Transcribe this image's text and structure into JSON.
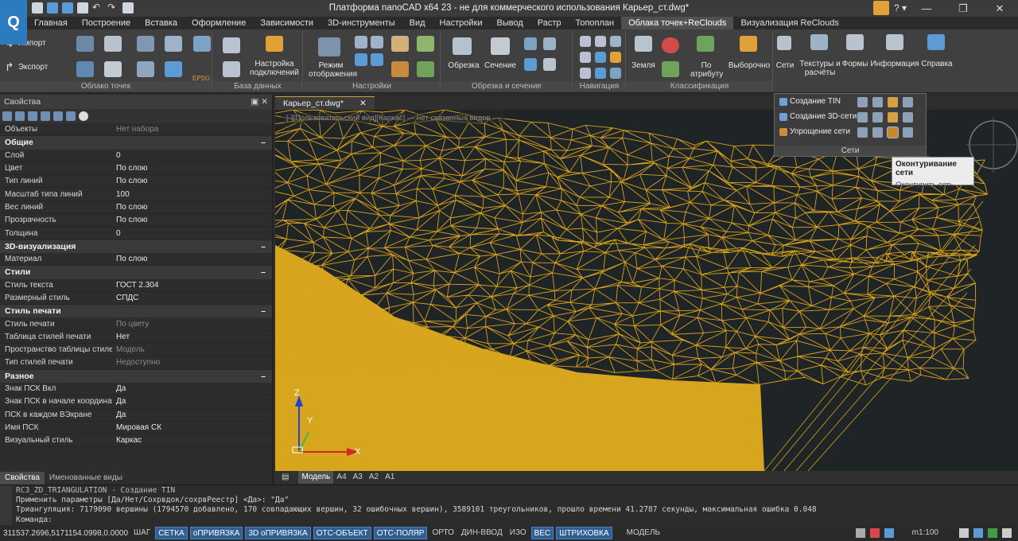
{
  "window": {
    "title": "Платформа nanoCAD x64 23 - не для коммерческого использования Карьер_ст.dwg*"
  },
  "app": {
    "logo_letter": "Q"
  },
  "ribbon_tabs": [
    "Главная",
    "Построение",
    "Вставка",
    "Оформление",
    "Зависимости",
    "3D-инструменты",
    "Вид",
    "Настройки",
    "Вывод",
    "Растр",
    "Топоплан",
    "Облака точек+ReClouds",
    "Визуализация ReClouds"
  ],
  "active_tab": "Облака точек+ReClouds",
  "ribbon": {
    "import_label": "Импорт",
    "export_label": "Экспорт",
    "epsg_label": "EPSG",
    "group_cloud": "Облако точек",
    "connections_label": "Настройка подключений",
    "group_db": "База данных",
    "display_mode_label": "Режим отображения",
    "group_settings": "Настройки",
    "cut_label": "Обрезка",
    "section_label": "Сечение",
    "group_cut": "Обрезка и сечение",
    "group_nav": "Навигация",
    "ground_label": "Земля",
    "by_attr_label": "По атрибуту",
    "selective_label": "Выборочно",
    "group_classif": "Классификация",
    "meshes_label": "Сети",
    "textures_label": "Текстуры и расчёты",
    "forms_label": "Формы",
    "info_label": "Информация",
    "help_label": "Справка"
  },
  "properties": {
    "header": "Свойства",
    "objects_key": "Объекты",
    "objects_val": "Нет набора",
    "sections": [
      {
        "title": "Общие",
        "rows": [
          {
            "k": "Слой",
            "v": "0"
          },
          {
            "k": "Цвет",
            "v": "По слою"
          },
          {
            "k": "Тип линий",
            "v": "По слою"
          },
          {
            "k": "Масштаб типа линий",
            "v": "100"
          },
          {
            "k": "Вес линий",
            "v": "По слою"
          },
          {
            "k": "Прозрачность",
            "v": "По слою"
          },
          {
            "k": "Толщина",
            "v": "0"
          }
        ]
      },
      {
        "title": "3D-визуализация",
        "rows": [
          {
            "k": "Материал",
            "v": "По слою"
          }
        ]
      },
      {
        "title": "Стили",
        "rows": [
          {
            "k": "Стиль текста",
            "v": "ГОСТ 2.304"
          },
          {
            "k": "Размерный стиль",
            "v": "СПДС"
          }
        ]
      },
      {
        "title": "Стиль печати",
        "rows": [
          {
            "k": "Стиль печати",
            "v": "По цвету"
          },
          {
            "k": "Таблица стилей печати",
            "v": "Нет"
          },
          {
            "k": "Пространство таблицы стилей п...",
            "v": "Модель"
          },
          {
            "k": "Тип стилей печати",
            "v": "Недоступно"
          }
        ]
      },
      {
        "title": "Разное",
        "rows": [
          {
            "k": "Знак ПСК Вкл",
            "v": "Да"
          },
          {
            "k": "Знак ПСК в начале координат",
            "v": "Да"
          },
          {
            "k": "ПСК в каждом ВЭкране",
            "v": "Да"
          },
          {
            "k": "Имя ПСК",
            "v": "Мировая СК"
          },
          {
            "k": "Визуальный стиль",
            "v": "Каркас"
          }
        ]
      }
    ],
    "bottom_tabs": [
      "Свойства",
      "Именованные виды"
    ]
  },
  "document": {
    "tab_label": "Карьер_ст.dwg*",
    "viewport_header": "[-][Пользовательский вид][Каркас] — нет связанных видов —"
  },
  "axes": {
    "z": "Z",
    "y": "Y",
    "x": "X"
  },
  "layout_tabs": [
    "Модель",
    "A4",
    "A3",
    "A2",
    "A1"
  ],
  "mesh_popup": {
    "items": [
      "Создание TIN",
      "Создание 3D-сети",
      "Упрощение сети"
    ],
    "footer": "Сети"
  },
  "tooltip": {
    "title": "Оконтуривание сети",
    "desc": "Оконтурить сеть"
  },
  "command_line": {
    "lines": [
      "RC3_ZD_TRIANGULATION - Создание TIN",
      "Применить параметры [Да/Нет/Сохрвдок/сохрвРеестр] <Да>: \"Да\"",
      "Триангуляция: 7179090 вершины (1794570 добавлено, 170 совпадающих вершин, 32 ошибочных вершин), 3589101 треугольников, прошло времени 41.2787 секунды, максимальная ошибка 0.048",
      "Команда:"
    ]
  },
  "status": {
    "coords": "311537.2696,5171154.0998,0.0000",
    "toggles": [
      {
        "label": "ШАГ",
        "on": false
      },
      {
        "label": "СЕТКА",
        "on": true
      },
      {
        "label": "оПРИВЯЗКА",
        "on": true
      },
      {
        "label": "3D оПРИВЯЗКА",
        "on": true
      },
      {
        "label": "ОТС-ОБЪЕКТ",
        "on": true
      },
      {
        "label": "ОТС-ПОЛЯР",
        "on": true
      },
      {
        "label": "ОРТО",
        "on": false
      },
      {
        "label": "ДИН-ВВОД",
        "on": false
      },
      {
        "label": "ИЗО",
        "on": false
      },
      {
        "label": "ВЕС",
        "on": true
      },
      {
        "label": "ШТРИХОВКА",
        "on": true
      }
    ],
    "model_label": "МОДЕЛЬ",
    "scale": "m1:100"
  },
  "colors": {
    "mesh": "#d9a21b",
    "ground": "#d8a51f",
    "background": "#1f2426",
    "accent": "#2f5f93"
  }
}
